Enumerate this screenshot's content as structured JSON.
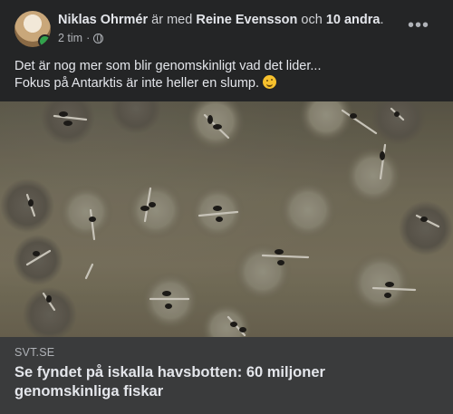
{
  "post": {
    "author": "Niklas Ohrmér",
    "with_text": "är med",
    "tagged": "Reine Evensson",
    "and_text": "och",
    "others": "10 andra",
    "end_punct": ".",
    "time": "2 tim",
    "dot": "·",
    "more": "•••",
    "text_line1": "Det är nog mer som blir genomskinligt vad det lider...",
    "text_line2": "Fokus på Antarktis är inte heller en slump."
  },
  "link": {
    "domain": "SVT.SE",
    "title": "Se fyndet på iskalla havsbotten: 60 miljoner genomskinliga fiskar"
  },
  "icons": {
    "avatar": "profile-photo",
    "online": "online-dot-icon",
    "privacy": "globe-icon",
    "emoji": "smirk-emoji-icon"
  },
  "colors": {
    "background": "#242526",
    "link_box": "#3a3b3c",
    "text": "#e4e6eb",
    "muted": "#b0b3b8",
    "online": "#31a24c"
  }
}
